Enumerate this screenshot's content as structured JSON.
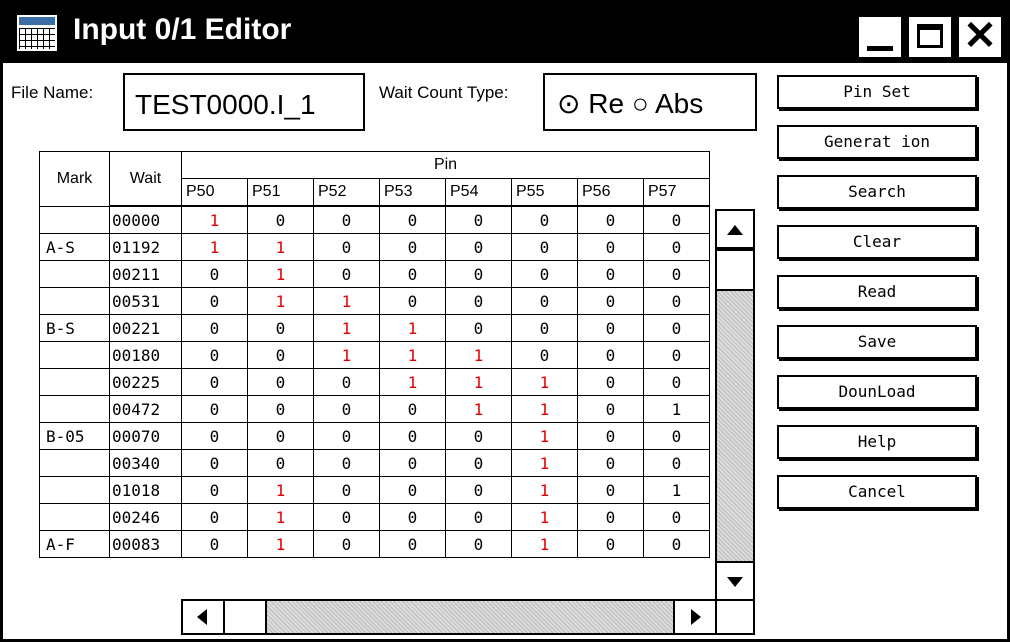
{
  "window": {
    "title": "Input 0/1 Editor"
  },
  "file": {
    "label": "File Name:",
    "value": "TEST0000.I_1"
  },
  "wait_type": {
    "label": "Wait Count Type:",
    "opt1": "Re",
    "opt2": "Abs",
    "selected": "Re"
  },
  "buttons": [
    "Pin Set",
    "Generat ion",
    "Search",
    "Clear",
    "Read",
    "Save",
    "DounLoad",
    "Help",
    "Cancel"
  ],
  "table": {
    "headers": {
      "mark": "Mark",
      "wait": "Wait",
      "pin": "Pin"
    },
    "pins": [
      "P50",
      "P51",
      "P52",
      "P53",
      "P54",
      "P55",
      "P56",
      "P57"
    ],
    "rows": [
      {
        "mark": "",
        "wait": "00000",
        "v": [
          "1",
          "0",
          "0",
          "0",
          "0",
          "0",
          "0",
          "0"
        ]
      },
      {
        "mark": "A-S",
        "wait": "01192",
        "v": [
          "1",
          "1",
          "0",
          "0",
          "0",
          "0",
          "0",
          "0"
        ]
      },
      {
        "mark": "",
        "wait": "00211",
        "v": [
          "0",
          "1",
          "0",
          "0",
          "0",
          "0",
          "0",
          "0"
        ]
      },
      {
        "mark": "",
        "wait": "00531",
        "v": [
          "0",
          "1",
          "1",
          "0",
          "0",
          "0",
          "0",
          "0"
        ]
      },
      {
        "mark": "B-S",
        "wait": "00221",
        "v": [
          "0",
          "0",
          "1",
          "1",
          "0",
          "0",
          "0",
          "0"
        ]
      },
      {
        "mark": "",
        "wait": "00180",
        "v": [
          "0",
          "0",
          "1",
          "1",
          "1",
          "0",
          "0",
          "0"
        ]
      },
      {
        "mark": "",
        "wait": "00225",
        "v": [
          "0",
          "0",
          "0",
          "1",
          "1",
          "1",
          "0",
          "0"
        ]
      },
      {
        "mark": "",
        "wait": "00472",
        "v": [
          "0",
          "0",
          "0",
          "0",
          "1",
          "1",
          "0",
          "1"
        ]
      },
      {
        "mark": "B-05",
        "wait": "00070",
        "v": [
          "0",
          "0",
          "0",
          "0",
          "0",
          "1",
          "0",
          "0"
        ]
      },
      {
        "mark": "",
        "wait": "00340",
        "v": [
          "0",
          "0",
          "0",
          "0",
          "0",
          "1",
          "0",
          "0"
        ]
      },
      {
        "mark": "",
        "wait": "01018",
        "v": [
          "0",
          "1",
          "0",
          "0",
          "0",
          "1",
          "0",
          "1"
        ]
      },
      {
        "mark": "",
        "wait": "00246",
        "v": [
          "0",
          "1",
          "0",
          "0",
          "0",
          "1",
          "0",
          "0"
        ]
      },
      {
        "mark": "A-F",
        "wait": "00083",
        "v": [
          "0",
          "1",
          "0",
          "0",
          "0",
          "1",
          "0",
          "0"
        ]
      }
    ],
    "red_columns": [
      "P50",
      "P51",
      "P52",
      "P53",
      "P54",
      "P55"
    ],
    "red_color": "#e00000"
  },
  "icons": [
    "app-grid-icon",
    "minimize-icon",
    "maximize-icon",
    "close-icon",
    "scroll-up-arrow-icon",
    "scroll-down-arrow-icon",
    "scroll-left-arrow-icon",
    "scroll-right-arrow-icon"
  ]
}
